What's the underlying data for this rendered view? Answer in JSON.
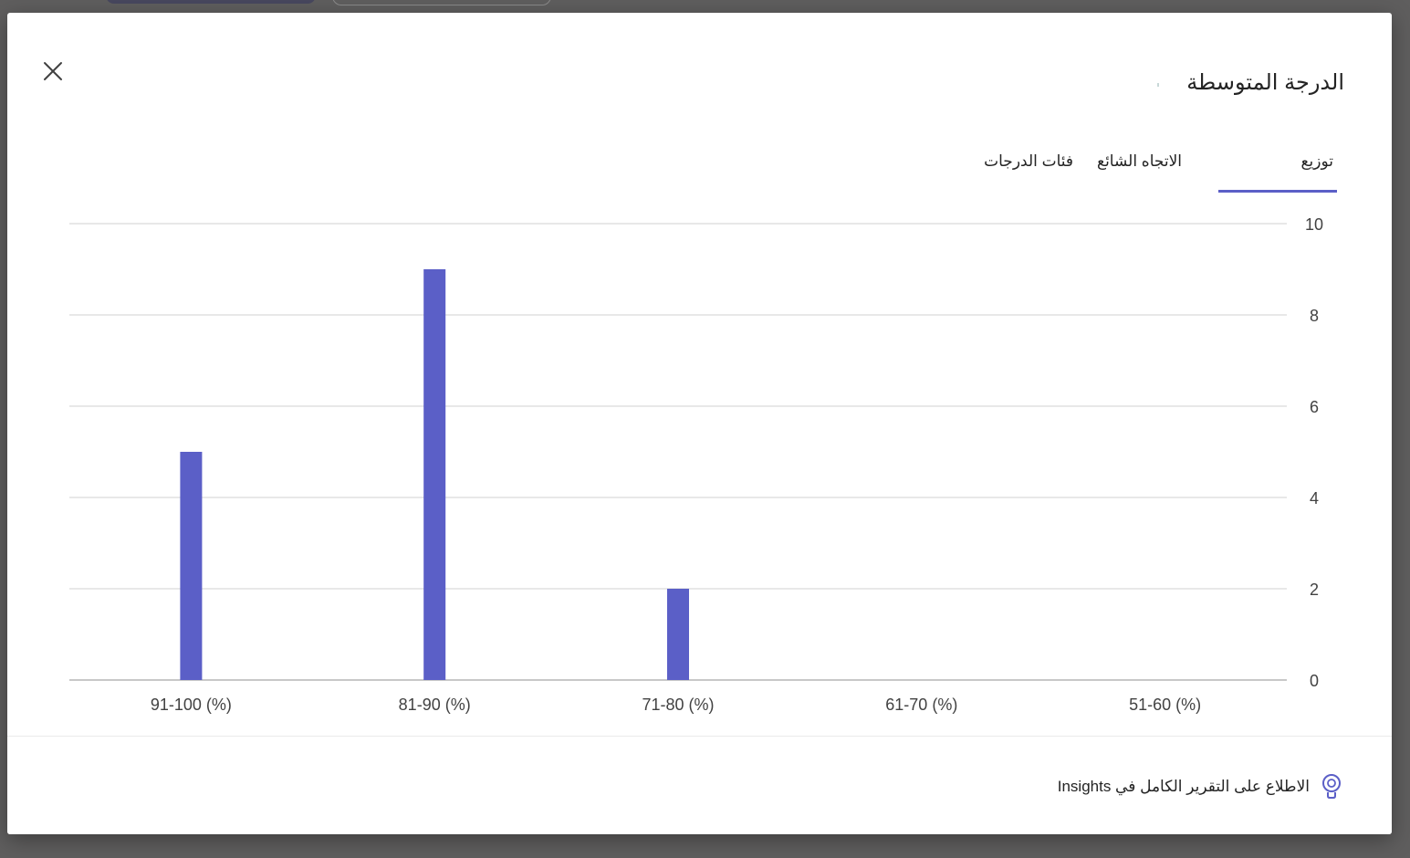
{
  "dialog": {
    "title": "الدرجة المتوسطة",
    "close_label": "إغلاق"
  },
  "tabs": [
    {
      "label": "توزيع",
      "active": true
    },
    {
      "label": "الاتجاه الشائع",
      "active": false
    },
    {
      "label": "فئات الدرجات",
      "active": false
    }
  ],
  "footer": {
    "insights_link": "الاطلاع على التقرير الكامل في Insights",
    "icon": "lightbulb-icon"
  },
  "colors": {
    "accent": "#5b5fc7",
    "bar": "#5b5fc7",
    "gridline": "#e1e1e1",
    "text": "#242424",
    "tick_text": "#424242"
  },
  "chart_data": {
    "type": "bar",
    "categories": [
      "51-60 (%)",
      "61-70 (%)",
      "71-80 (%)",
      "81-90 (%)",
      "91-100 (%)"
    ],
    "tick_labels_x": [
      "51-60 (%)",
      "61-70 (%)",
      "71-80 (%)",
      "81-90 (%)",
      "91-100 (%)"
    ],
    "values": [
      0,
      0,
      2,
      9,
      5
    ],
    "ylim": [
      0,
      10
    ],
    "yticks": [
      0,
      2,
      4,
      6,
      8,
      10
    ],
    "ytick_labels": [
      "0",
      "2",
      "4",
      "6",
      "8",
      "10"
    ],
    "y_axis_side": "right",
    "category_order": "right-to-left",
    "grid": true,
    "title": "",
    "xlabel": "",
    "ylabel": ""
  }
}
